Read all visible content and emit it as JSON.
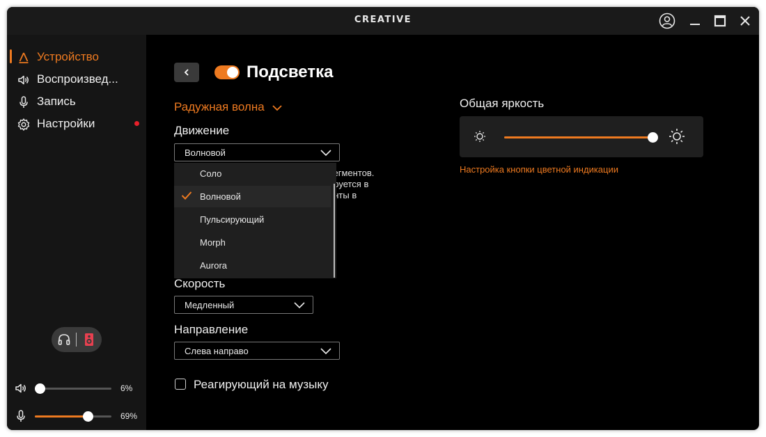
{
  "titlebar": {
    "brand": "CREATIVE",
    "icons": [
      "account-icon",
      "minimize-icon",
      "maximize-icon",
      "close-icon"
    ]
  },
  "sidebar": {
    "items": [
      {
        "label": "Устройство",
        "icon": "device-icon",
        "active": true
      },
      {
        "label": "Воспроизвед...",
        "icon": "speaker-icon",
        "active": false
      },
      {
        "label": "Запись",
        "icon": "microphone-icon",
        "active": false
      },
      {
        "label": "Настройки",
        "icon": "gear-icon",
        "active": false,
        "badge": "red-dot"
      }
    ],
    "output_devices": [
      "headphones-icon",
      "speaker-device-icon"
    ],
    "playback_volume": {
      "value": 0.06,
      "label": "6%"
    },
    "mic_volume": {
      "value": 0.69,
      "label": "69%"
    }
  },
  "main": {
    "title": "Подсветка",
    "lighting_enabled": true,
    "effect": "Радужная волна",
    "motion": {
      "label": "Движение",
      "selected": "Волновой",
      "options": [
        "Соло",
        "Волновой",
        "Пульсирующий",
        "Morph",
        "Aurora"
      ],
      "description_fragments": [
        "сегментов.",
        "ируется в",
        "енты в"
      ]
    },
    "speed": {
      "label": "Скорость",
      "selected": "Медленный"
    },
    "direction": {
      "label": "Направление",
      "selected": "Слева направо"
    },
    "music_reactive": {
      "label": "Реагирующий на музыку",
      "checked": false
    },
    "brightness": {
      "label": "Общая яркость",
      "value": 1.0
    },
    "indicator_link": "Настройка кнопки цветной индикации"
  },
  "colors": {
    "accent": "#ee7a20",
    "background": "#000000",
    "sidebar": "#151515",
    "badge": "#e8202a"
  }
}
